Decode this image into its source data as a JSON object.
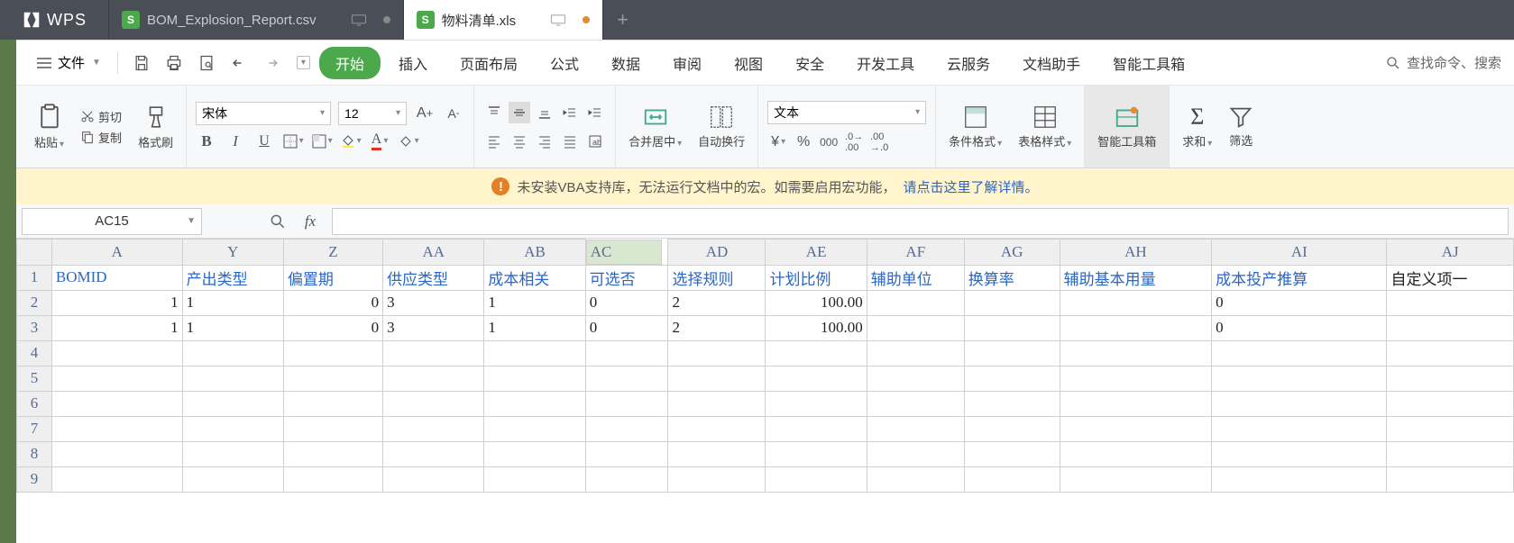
{
  "app": {
    "logo": "WPS"
  },
  "tabs": [
    {
      "icon": "S",
      "label": "BOM_Explosion_Report.csv",
      "active": false,
      "dot": "gray"
    },
    {
      "icon": "S",
      "label": "物料清单.xls",
      "active": true,
      "dot": "orange"
    }
  ],
  "menu": {
    "file": "文件",
    "items": [
      "开始",
      "插入",
      "页面布局",
      "公式",
      "数据",
      "审阅",
      "视图",
      "安全",
      "开发工具",
      "云服务",
      "文档助手",
      "智能工具箱"
    ],
    "active": "开始",
    "search": "查找命令、搜索"
  },
  "ribbon": {
    "paste": "粘贴",
    "cut": "剪切",
    "copy": "复制",
    "fmtpaint": "格式刷",
    "font_name": "宋体",
    "font_size": "12",
    "merge": "合并居中",
    "wrap": "自动换行",
    "numfmt": "文本",
    "condfmt": "条件格式",
    "tblstyle": "表格样式",
    "smarttool": "智能工具箱",
    "sum": "求和",
    "filter": "筛选"
  },
  "warn": {
    "text": "未安装VBA支持库，无法运行文档中的宏。如需要启用宏功能，",
    "link": "请点击这里了解详情。"
  },
  "namebox": "AC15",
  "cols": [
    "A",
    "Y",
    "Z",
    "AA",
    "AB",
    "AC",
    "AD",
    "AE",
    "AF",
    "AG",
    "AH",
    "AI",
    "AJ"
  ],
  "selected_col": "AC",
  "headers": {
    "A": "BOMID",
    "Y": "产出类型",
    "Z": "偏置期",
    "AA": "供应类型",
    "AB": "成本相关",
    "AC": "可选否",
    "AD": "选择规则",
    "AE": "计划比例",
    "AF": "辅助单位",
    "AG": "换算率",
    "AH": "辅助基本用量",
    "AI": "成本投产推算",
    "AJ": "自定义项一"
  },
  "rows": [
    {
      "A": "1",
      "Y": "1",
      "Z": "0",
      "AA": "3",
      "AB": "1",
      "AC": "0",
      "AD": "2",
      "AE": "100.00",
      "AF": "",
      "AG": "",
      "AH": "",
      "AI": "0",
      "AJ": ""
    },
    {
      "A": "1",
      "Y": "1",
      "Z": "0",
      "AA": "3",
      "AB": "1",
      "AC": "0",
      "AD": "2",
      "AE": "100.00",
      "AF": "",
      "AG": "",
      "AH": "",
      "AI": "0",
      "AJ": ""
    }
  ],
  "blank_rows": 6
}
